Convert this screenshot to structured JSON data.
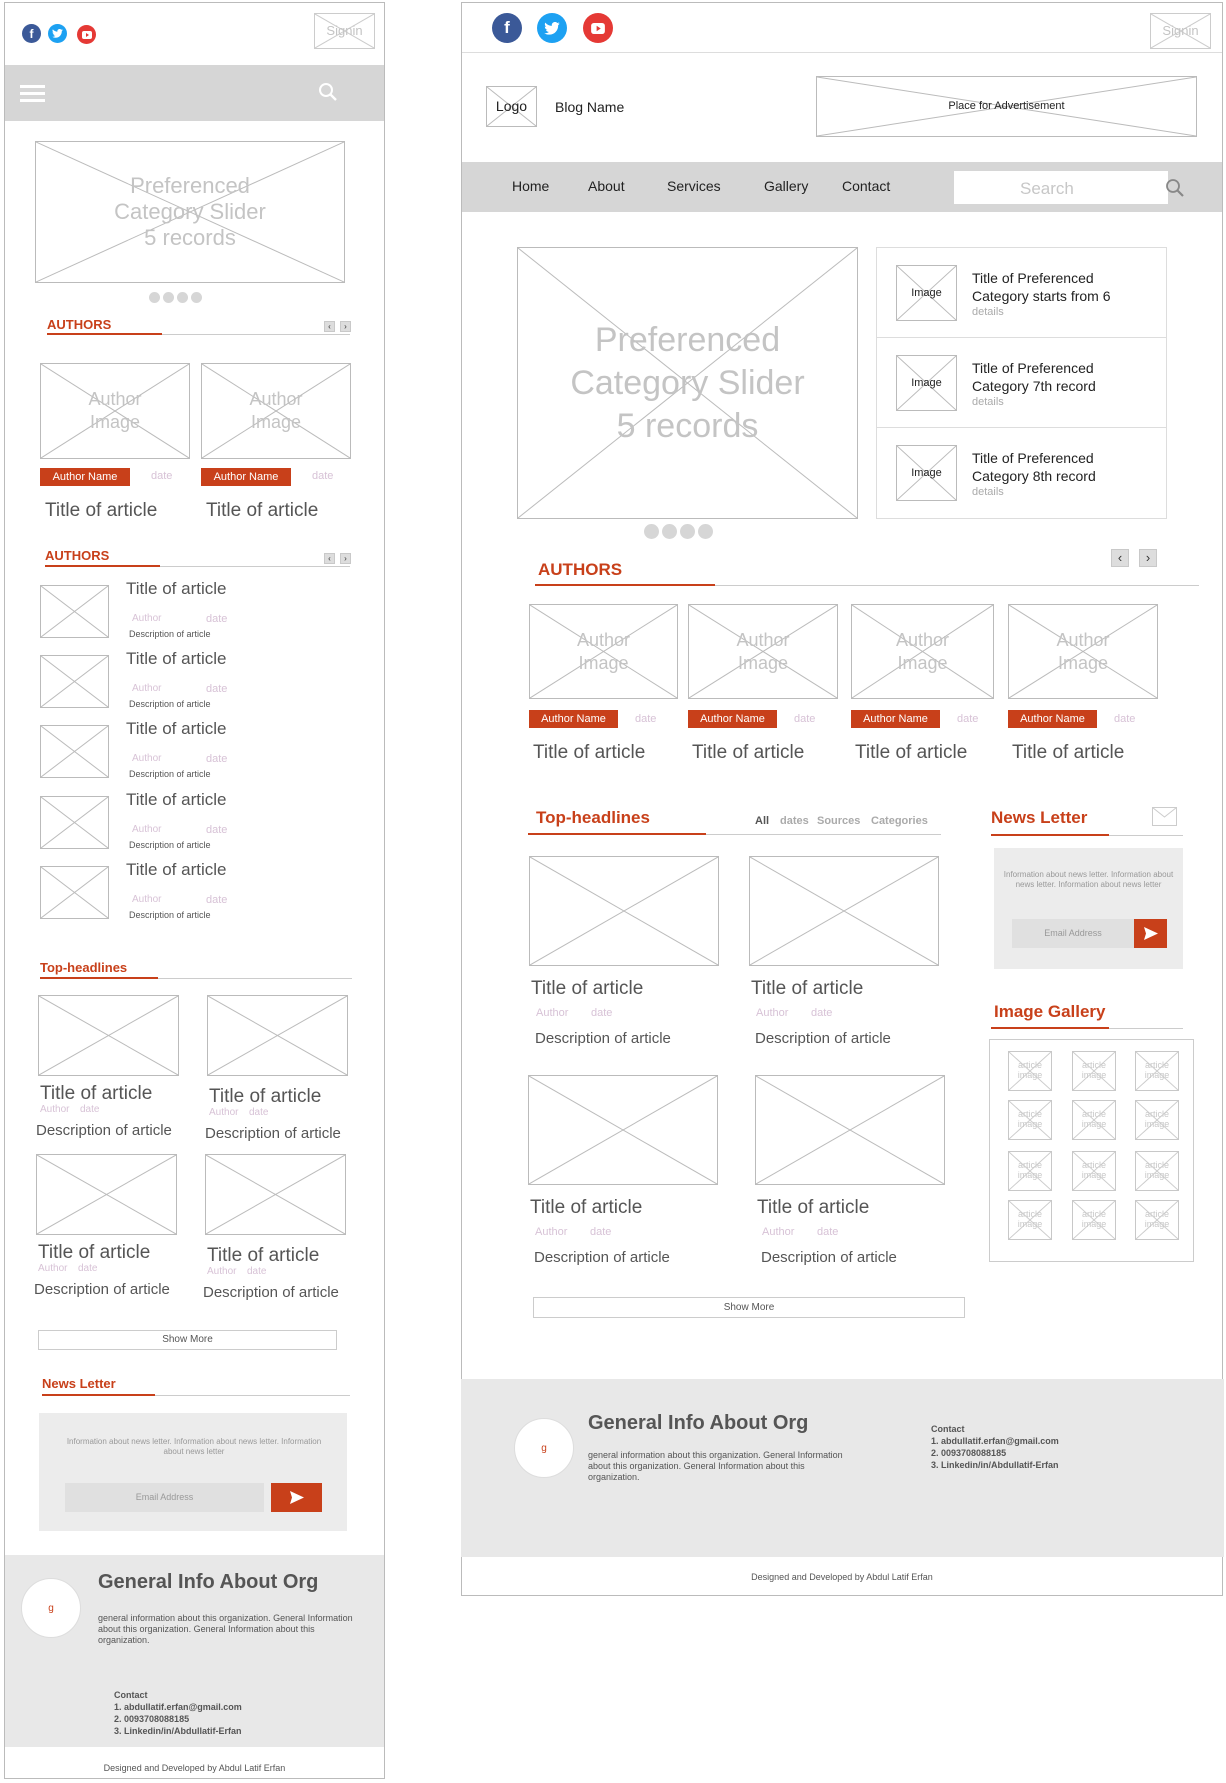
{
  "social": {
    "facebook": "f",
    "twitter": "twitter",
    "youtube": "youtube",
    "colors": {
      "facebook": "#3b5998",
      "twitter": "#1da1f2",
      "youtube": "#e53935"
    }
  },
  "accent": "#c8401a",
  "signin": "Signin",
  "slider": {
    "line1": "Preferenced",
    "line2": "Category Slider",
    "line3": "5 records"
  },
  "authors": {
    "heading": "AUTHORS",
    "image_label_1": "Author",
    "image_label_2": "Image",
    "name": "Author Name",
    "date": "date",
    "title": "Title of article"
  },
  "article": {
    "title": "Title of article",
    "author": "Author",
    "date": "date",
    "description": "Description of article",
    "description_short": "Description of article"
  },
  "top_headlines": {
    "heading": "Top-headlines",
    "tabs": [
      "All",
      "dates",
      "Sources",
      "Categories"
    ]
  },
  "show_more": "Show More",
  "newsletter": {
    "heading": "News Letter",
    "info": "Information about news letter. Information about news letter. Information about news letter",
    "email_placeholder": "Email Address"
  },
  "gallery": {
    "heading": "Image Gallery",
    "item_line1": "article",
    "item_line2": "image"
  },
  "footer": {
    "org_title": "General Info About Org",
    "org_text": "general information about this organization.  General Information about this organization. General Information about this organization.",
    "logo": "g",
    "contact_heading": "Contact",
    "contacts": [
      "1. abdullatif.erfan@gmail.com",
      "2. 0093708088185",
      "3. Linkedin/in/Abdullatif-Erfan"
    ],
    "credit": "Designed and Developed by Abdul Latif Erfan"
  },
  "header": {
    "logo": "Logo",
    "blog_name": "Blog Name",
    "ad": "Place for Advertisement"
  },
  "nav": {
    "items": [
      "Home",
      "About",
      "Services",
      "Gallery",
      "Contact"
    ],
    "search_placeholder": "Search"
  },
  "side_articles": [
    {
      "image": "Image",
      "title": "Title of Preferenced Category starts from 6",
      "details": "details"
    },
    {
      "image": "Image",
      "title": "Title of Preferenced Category 7th record",
      "details": "details"
    },
    {
      "image": "Image",
      "title": "Title of Preferenced Category 8th record",
      "details": "details"
    }
  ]
}
